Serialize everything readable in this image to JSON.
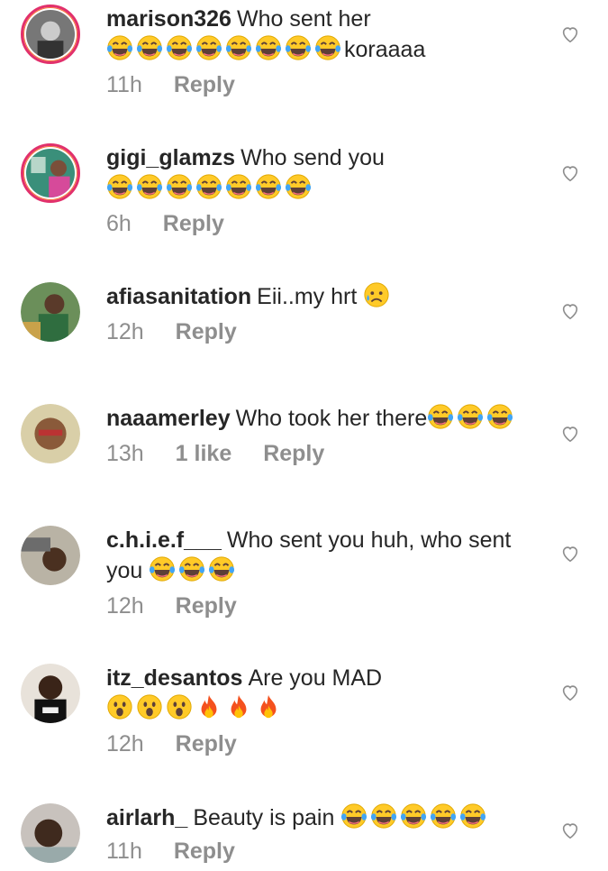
{
  "comments": [
    {
      "username": "marison326",
      "text": "Who sent her",
      "line2_text": "koraaaa",
      "emojis_line1": [],
      "emojis_line2": [
        "laugh-cry",
        "laugh-cry",
        "laugh-cry",
        "laugh-cry",
        "laugh-cry",
        "laugh-cry",
        "laugh-cry",
        "laugh-cry"
      ],
      "time": "11h",
      "likes": "",
      "reply": "Reply",
      "story_ring": true
    },
    {
      "username": "gigi_glamzs",
      "text": "Who send you",
      "line2_text": "",
      "emojis_line1": [],
      "emojis_line2": [
        "laugh-cry",
        "laugh-cry",
        "laugh-cry",
        "laugh-cry",
        "laugh-cry",
        "laugh-cry",
        "laugh-cry"
      ],
      "time": "6h",
      "likes": "",
      "reply": "Reply",
      "story_ring": true
    },
    {
      "username": "afiasanitation",
      "text": "Eii..my hrt",
      "line2_text": "",
      "emojis_line1": [
        "sad-sweat"
      ],
      "emojis_line2": [],
      "time": "12h",
      "likes": "",
      "reply": "Reply",
      "story_ring": false
    },
    {
      "username": "naaamerley",
      "text": "Who took her there",
      "line2_text": "",
      "emojis_line1": [
        "laugh-cry",
        "laugh-cry",
        "laugh-cry"
      ],
      "emojis_line2": [],
      "time": "13h",
      "likes": "1 like",
      "reply": "Reply",
      "story_ring": false
    },
    {
      "username": "c.h.i.e.f___",
      "text": "Who sent you huh, who sent",
      "line2_text": "you",
      "emojis_line1": [],
      "emojis_line2": [
        "laugh-cry",
        "laugh-cry",
        "laugh-cry"
      ],
      "time": "12h",
      "likes": "",
      "reply": "Reply",
      "story_ring": false
    },
    {
      "username": "itz_desantos",
      "text": "Are you MAD",
      "line2_text": "",
      "emojis_line1": [],
      "emojis_line2": [
        "surprised",
        "surprised",
        "surprised",
        "fire",
        "fire",
        "fire"
      ],
      "time": "12h",
      "likes": "",
      "reply": "Reply",
      "story_ring": false
    },
    {
      "username": "airlarh_",
      "text": "Beauty is pain",
      "line2_text": "",
      "emojis_line1": [
        "laugh-cry",
        "laugh-cry",
        "laugh-cry",
        "laugh-cry",
        "laugh-cry"
      ],
      "emojis_line2": [],
      "time": "11h",
      "likes": "",
      "reply": "Reply",
      "story_ring": false
    }
  ],
  "colors": {
    "username": "#262626",
    "meta": "#8e8e8e",
    "story_ring": "#e1306c"
  }
}
